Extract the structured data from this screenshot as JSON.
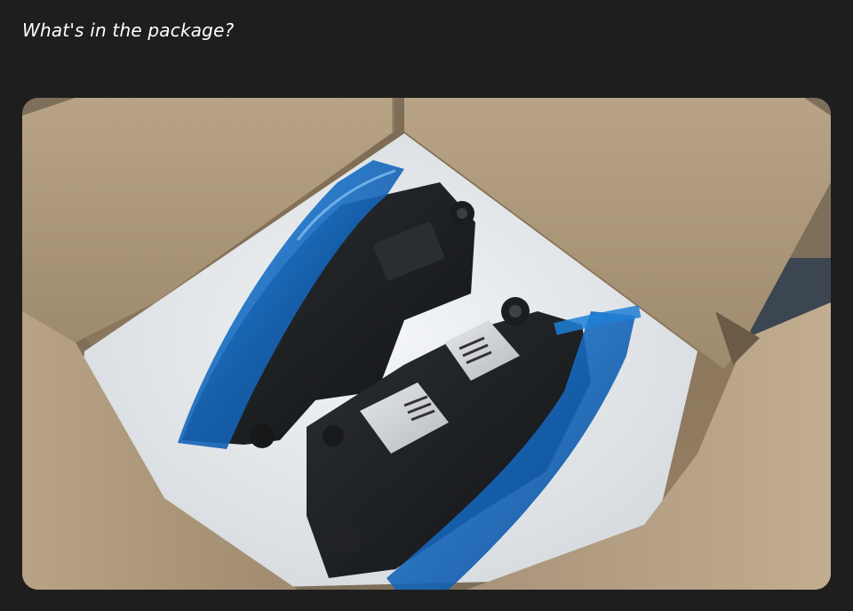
{
  "heading": "What's in the package?",
  "photo": {
    "alt": "Cardboard box with foam lining containing two black headlight assemblies wrapped in blue protective film"
  },
  "colors": {
    "background": "#1e1e1e",
    "heading_text": "#ffffff",
    "cardboard": "#b39d80",
    "film_blue": "#1f7fd6",
    "foam": "#eceff2"
  }
}
